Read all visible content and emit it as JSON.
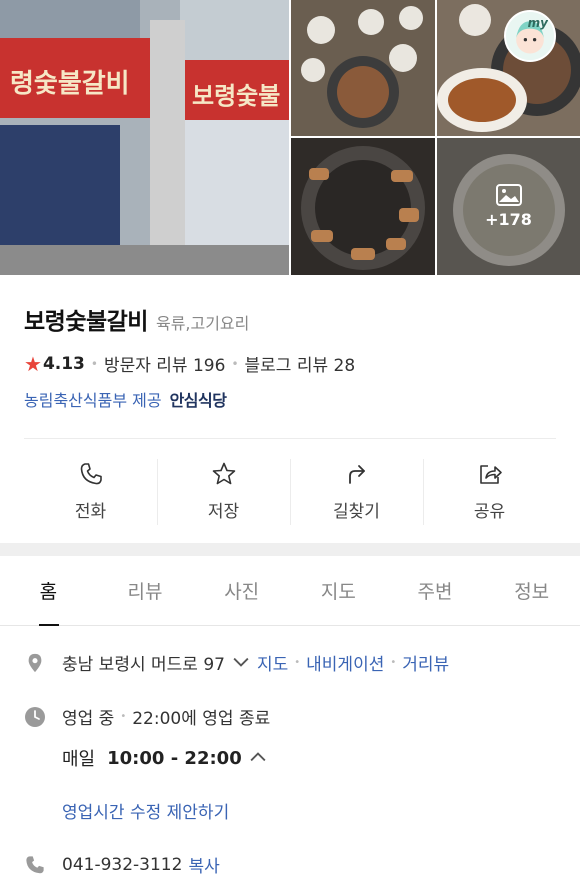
{
  "gallery": {
    "more_count": "+178",
    "my_badge": "my"
  },
  "place": {
    "name": "보령숯불갈비",
    "category": "육류,고기요리",
    "rating": "4.13",
    "visitor_reviews": "방문자 리뷰 196",
    "blog_reviews": "블로그 리뷰 28",
    "cert_source": "농림축산식품부 제공",
    "cert_badge": "안심식당"
  },
  "actions": [
    {
      "label": "전화",
      "icon": "phone-icon"
    },
    {
      "label": "저장",
      "icon": "star-icon"
    },
    {
      "label": "길찾기",
      "icon": "directions-icon"
    },
    {
      "label": "공유",
      "icon": "share-icon"
    }
  ],
  "tabs": [
    {
      "label": "홈",
      "active": true
    },
    {
      "label": "리뷰"
    },
    {
      "label": "사진"
    },
    {
      "label": "지도"
    },
    {
      "label": "주변"
    },
    {
      "label": "정보"
    }
  ],
  "info": {
    "address": "충남 보령시 머드로 97",
    "address_links": [
      "지도",
      "내비게이션",
      "거리뷰"
    ],
    "status": "영업 중",
    "status_detail": "22:00에 영업 종료",
    "hours_day": "매일",
    "hours_time": "10:00 - 22:00",
    "suggest_edit": "영업시간 수정 제안하기",
    "phone": "041-932-3112",
    "phone_copy": "복사"
  },
  "colors": {
    "link": "#3a64b4",
    "star": "#e8443a"
  }
}
